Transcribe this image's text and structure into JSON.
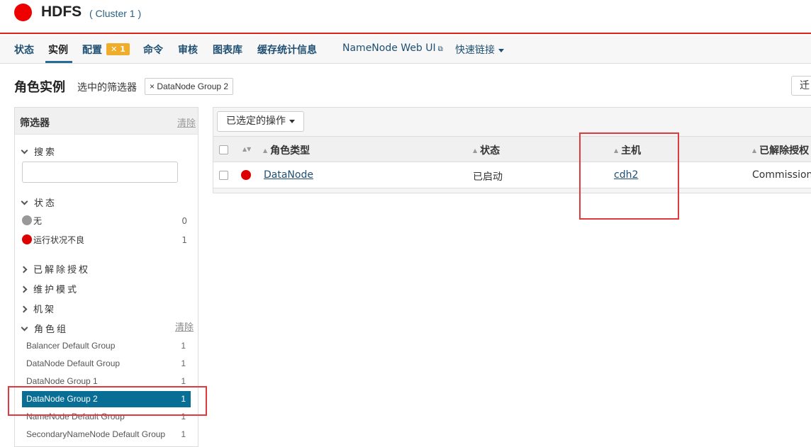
{
  "header": {
    "service_name": "HDFS",
    "cluster": "( Cluster 1 )",
    "status_color": "#ee0000"
  },
  "nav": {
    "tabs": [
      "状态",
      "实例",
      "配置",
      "命令",
      "审核",
      "图表库",
      "缓存统计信息"
    ],
    "active_tab": "实例",
    "config_badge": "1",
    "config_badge_icon": "wrench-icon",
    "namenode_ui": "NameNode Web UI",
    "quick_links": "快速链接"
  },
  "page": {
    "title": "角色实例",
    "selected_filters_label": "选中的筛选器",
    "filter_chip": "× DataNode Group 2",
    "migrate_button": "迁"
  },
  "sidebar": {
    "title": "筛选器",
    "clear": "清除",
    "search_label": "搜索",
    "search_value": "",
    "status_label": "状态",
    "status_items": [
      {
        "label": "无",
        "count": "0",
        "color": "#999999"
      },
      {
        "label": "运行状况不良",
        "count": "1",
        "color": "#dd0000"
      }
    ],
    "collapsed_sections": [
      "已解除授权",
      "维护模式",
      "机架"
    ],
    "role_group_label": "角色组",
    "role_group_clear": "清除",
    "role_groups": [
      {
        "label": "Balancer Default Group",
        "count": "1"
      },
      {
        "label": "DataNode Default Group",
        "count": "1"
      },
      {
        "label": "DataNode Group 1",
        "count": "1"
      },
      {
        "label": "DataNode Group 2",
        "count": "1",
        "selected": true
      },
      {
        "label": "NameNode Default Group",
        "count": "1"
      },
      {
        "label": "SecondaryNameNode Default Group",
        "count": "1"
      }
    ]
  },
  "table": {
    "actions_button": "已选定的操作",
    "columns": [
      "角色类型",
      "状态",
      "主机",
      "已解除授权"
    ],
    "rows": [
      {
        "role_type": "DataNode",
        "status": "已启动",
        "host": "cdh2",
        "commission": "Commissioned",
        "health_color": "#dd0000"
      }
    ]
  }
}
